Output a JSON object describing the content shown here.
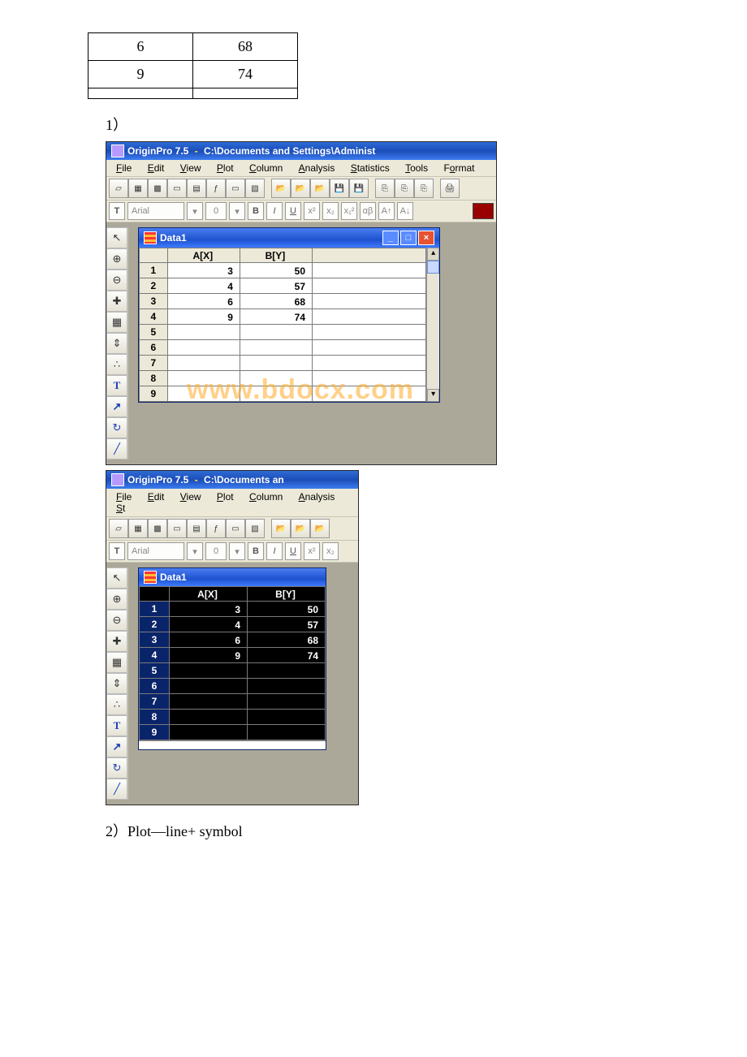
{
  "top_table": {
    "rows": [
      {
        "c1": "6",
        "c2": "68"
      },
      {
        "c1": "9",
        "c2": "74"
      },
      {
        "c1": "",
        "c2": ""
      }
    ]
  },
  "step1_label": "1）",
  "win1": {
    "title_prefix": "OriginPro 7.5 ",
    "title_dash": "-",
    "title_path": " C:\\Documents and Settings\\Administ",
    "menus": [
      "File",
      "Edit",
      "View",
      "Plot",
      "Column",
      "Analysis",
      "Statistics",
      "Tools",
      "Format"
    ],
    "font_name": "Arial",
    "font_size": "0",
    "side_tools": [
      "↖",
      "⊕",
      "⊖",
      "✚",
      "▦",
      "⇕",
      "∴",
      "T",
      "↗",
      "↻",
      "╱"
    ],
    "data_title": "Data1",
    "headers": [
      "",
      "A[X]",
      "B[Y]",
      ""
    ],
    "rows": [
      {
        "n": "1",
        "a": "3",
        "b": "50"
      },
      {
        "n": "2",
        "a": "4",
        "b": "57"
      },
      {
        "n": "3",
        "a": "6",
        "b": "68"
      },
      {
        "n": "4",
        "a": "9",
        "b": "74"
      },
      {
        "n": "5",
        "a": "",
        "b": ""
      },
      {
        "n": "6",
        "a": "",
        "b": ""
      },
      {
        "n": "7",
        "a": "",
        "b": ""
      },
      {
        "n": "8",
        "a": "",
        "b": ""
      },
      {
        "n": "9",
        "a": "",
        "b": ""
      }
    ],
    "watermark": "www.bdocx.com"
  },
  "win2": {
    "title_prefix": "OriginPro 7.5 ",
    "title_dash": "-",
    "title_path": " C:\\Documents an",
    "menus": [
      "File",
      "Edit",
      "View",
      "Plot",
      "Column",
      "Analysis",
      "St"
    ],
    "font_name": "Arial",
    "font_size": "0",
    "side_tools": [
      "↖",
      "⊕",
      "⊖",
      "✚",
      "▦",
      "⇕",
      "∴",
      "T",
      "↗",
      "↻",
      "╱"
    ],
    "data_title": "Data1",
    "headers": [
      "",
      "A[X]",
      "B[Y]"
    ],
    "rows": [
      {
        "n": "1",
        "a": "3",
        "b": "50"
      },
      {
        "n": "2",
        "a": "4",
        "b": "57"
      },
      {
        "n": "3",
        "a": "6",
        "b": "68"
      },
      {
        "n": "4",
        "a": "9",
        "b": "74"
      },
      {
        "n": "5",
        "a": "",
        "b": ""
      },
      {
        "n": "6",
        "a": "",
        "b": ""
      },
      {
        "n": "7",
        "a": "",
        "b": ""
      },
      {
        "n": "8",
        "a": "",
        "b": ""
      },
      {
        "n": "9",
        "a": "",
        "b": ""
      }
    ]
  },
  "step2_label": "2）Plot—line+ symbol",
  "chart_data": {
    "type": "table",
    "title": "Data1",
    "columns": [
      "A[X]",
      "B[Y]"
    ],
    "x": [
      3,
      4,
      6,
      9
    ],
    "y": [
      50,
      57,
      68,
      74
    ]
  }
}
